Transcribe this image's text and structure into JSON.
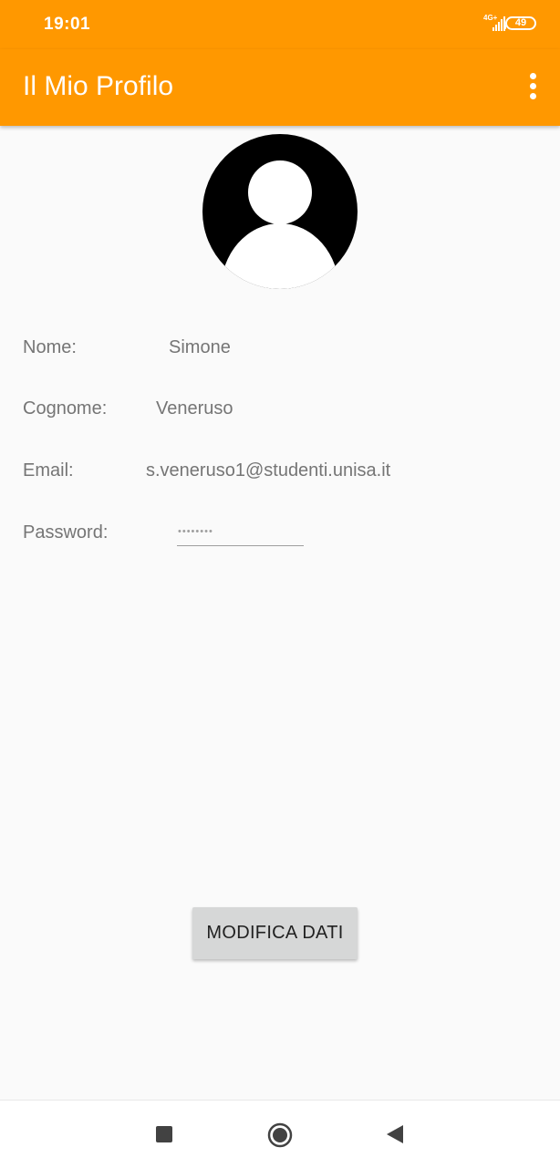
{
  "status_bar": {
    "time": "19:01",
    "network": "4G+",
    "battery": "49"
  },
  "app_bar": {
    "title": "Il Mio Profilo",
    "menu_icon": "more-vert-icon"
  },
  "profile": {
    "avatar_icon": "account-circle-icon",
    "fields": [
      {
        "label": "Nome:",
        "value": "Simone"
      },
      {
        "label": "Cognome:",
        "value": "Veneruso"
      },
      {
        "label": "Email:",
        "value": "s.veneruso1@studenti.unisa.it"
      },
      {
        "label": "Password:",
        "value": "••••••••"
      }
    ]
  },
  "actions": {
    "edit_label": "MODIFICA DATI"
  },
  "colors": {
    "primary": "#FF9800",
    "background": "#FAFAFA",
    "text_secondary": "#757575",
    "button": "#D6D7D7"
  },
  "nav": {
    "recents_icon": "square-icon",
    "home_icon": "circle-icon",
    "back_icon": "triangle-back-icon"
  }
}
